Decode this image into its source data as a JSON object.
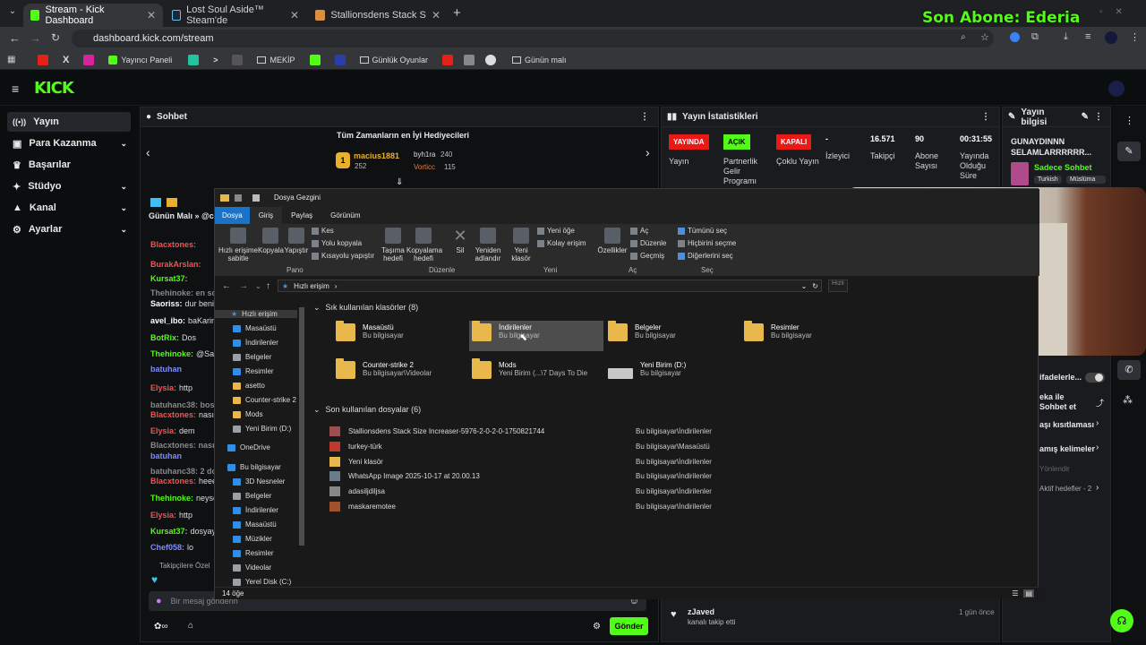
{
  "browser": {
    "tabs": [
      {
        "title": "Stream - Kick Dashboard",
        "active": true
      },
      {
        "title": "Lost Soul Aside™ Steam'de",
        "active": false
      },
      {
        "title": "Stallionsdens Stack Size Increas",
        "active": false
      }
    ],
    "url": "dashboard.kick.com/stream",
    "bookmarks": [
      "Yayıncı Paneli",
      "MEKİP",
      "Günlük Oyunlar",
      "Günün malı"
    ]
  },
  "overlay": {
    "text": "Son Abone: Ederia"
  },
  "kick": {
    "logo": "KICK",
    "nav": [
      {
        "label": "Yayın",
        "chevron": false
      },
      {
        "label": "Para Kazanma",
        "chevron": true
      },
      {
        "label": "Başarılar",
        "chevron": false
      },
      {
        "label": "Stüdyo",
        "chevron": true
      },
      {
        "label": "Kanal",
        "chevron": true
      },
      {
        "label": "Ayarlar",
        "chevron": true
      }
    ],
    "chat": {
      "title": "Sohbet",
      "gifters_title": "Tüm Zamanların en İyi Hediyecileri",
      "gifters": [
        {
          "name": "macius1881",
          "count": "252"
        },
        {
          "name": "byh1ra",
          "count": "240"
        },
        {
          "name": "Vorticc",
          "count": "115"
        }
      ],
      "pinned": "Günün Malı » @c",
      "messages": [
        {
          "user": "Blacxtones:",
          "text": "",
          "color": "#ff4d4d"
        },
        {
          "user": "BurakArslan:",
          "text": "",
          "color": "#ff4d4d"
        },
        {
          "user": "Kursat37:",
          "text": "",
          "color": "#53fc18"
        },
        {
          "user": "Thehinoke: en son",
          "text": "",
          "color": "#888"
        },
        {
          "user": "Saoriss:",
          "text": "dur benim",
          "color": "#fff"
        },
        {
          "user": "avel_ibo:",
          "text": "baKarim",
          "color": "#fff"
        },
        {
          "user": "BotRix:",
          "text": "Dos",
          "color": "#53fc18"
        },
        {
          "user": "Thehinoke:",
          "text": "@Saori",
          "color": "#53fc18"
        },
        {
          "user": "batuhan",
          "text": "",
          "color": "#7f8cff"
        },
        {
          "user": "Elysia:",
          "text": "http",
          "color": "#ff4d4d"
        },
        {
          "user": "batuhanc38: bos",
          "text": "",
          "color": "#888"
        },
        {
          "user": "Blacxtones:",
          "text": "nasıl k",
          "color": "#ff4d4d"
        },
        {
          "user": "Elysia:",
          "text": "dem",
          "color": "#ff4d4d"
        },
        {
          "user": "Blacxtones: nasıl",
          "text": "",
          "color": "#888"
        },
        {
          "user": "batuhan",
          "text": "",
          "color": "#7f8cff"
        },
        {
          "user": "batuhanc38: 2 do",
          "text": "",
          "color": "#888"
        },
        {
          "user": "Blacxtones:",
          "text": "heee k",
          "color": "#ff4d4d"
        },
        {
          "user": "Thehinoke:",
          "text": "neyse",
          "color": "#53fc18"
        },
        {
          "user": "Elysia:",
          "text": "http",
          "color": "#ff4d4d"
        },
        {
          "user": "Kursat37:",
          "text": "dosyayı",
          "color": "#53fc18"
        },
        {
          "user": "Chef058:",
          "text": "lo",
          "color": "#7f8cff"
        }
      ],
      "followers_only": "Takipçilere Özel",
      "input_placeholder": "Bir mesaj gönderin",
      "send": "Gönder"
    },
    "stats": {
      "title": "Yayın İstatistikleri",
      "badges": [
        {
          "label": "YAYINDA",
          "color": "#e91916",
          "caption": "Yayın"
        },
        {
          "label": "AÇIK",
          "color": "#53fc18",
          "caption": "Partnerlik Gelir Programı"
        },
        {
          "label": "KAPALI",
          "color": "#e91916",
          "caption": "Çoklu Yayın"
        }
      ],
      "values": [
        {
          "value": "-",
          "caption": "İzleyici"
        },
        {
          "value": "16.571",
          "caption": "Takipçi"
        },
        {
          "value": "90",
          "caption": "Abone Sayısı"
        },
        {
          "value": "00:31:55",
          "caption": "Yayında Olduğu Süre"
        }
      ]
    },
    "info": {
      "title": "Yayın bilgisi",
      "stream_title": "GUNAYDINNN SELAMLARRRRRR...",
      "category": "Sadece Sohbet",
      "tags": [
        "Turkish",
        "Müslüma"
      ],
      "settings": [
        "ifadelerle...",
        "eka ile Sohbet et",
        "aşı kısıtlaması",
        "amış kelimeler",
        "Yönlendir",
        "Aktif hedefler - 2"
      ]
    },
    "activity": {
      "user": "zJaved",
      "text": "kanalı takip etti",
      "time": "1 gün önce"
    }
  },
  "explorer": {
    "title": "Dosya Gezgini",
    "tabs": [
      "Dosya",
      "Giriş",
      "Paylaş",
      "Görünüm"
    ],
    "ribbon": {
      "pin": "Hızlı erişime sabitle",
      "copy": "Kopyala",
      "paste": "Yapıştır",
      "cut": "Kes",
      "copy_path": "Yolu kopyala",
      "paste_shortcut": "Kısayolu yapıştır",
      "move_to": "Taşıma hedefi",
      "copy_to": "Kopyalama hedefi",
      "delete": "Sil",
      "rename": "Yeniden adlandır",
      "new_folder": "Yeni klasör",
      "new_item": "Yeni öğe",
      "easy_access": "Kolay erişim",
      "properties": "Özellikler",
      "open": "Aç",
      "edit": "Düzenle",
      "history": "Geçmiş",
      "select_all": "Tümünü seç",
      "select_none": "Hiçbirini seçme",
      "invert": "Diğerlerini seç",
      "groups": [
        "Pano",
        "Düzenle",
        "Yeni",
        "Aç",
        "Seç"
      ]
    },
    "path": "Hızlı erişim",
    "search_placeholder": "Hızlı",
    "nav": [
      {
        "label": "Hızlı erişim",
        "type": "star"
      },
      {
        "label": "Masaüstü",
        "type": "b"
      },
      {
        "label": "İndirilenler",
        "type": "b"
      },
      {
        "label": "Belgeler",
        "type": "g"
      },
      {
        "label": "Resimler",
        "type": "b"
      },
      {
        "label": "asetto",
        "type": "f"
      },
      {
        "label": "Counter-strike 2",
        "type": "f"
      },
      {
        "label": "Mods",
        "type": "f"
      },
      {
        "label": "Yeni Birim (D:)",
        "type": "g"
      },
      {
        "label": "OneDrive",
        "type": "b"
      },
      {
        "label": "Bu bilgisayar",
        "type": "b"
      },
      {
        "label": "3D Nesneler",
        "type": "b"
      },
      {
        "label": "Belgeler",
        "type": "g"
      },
      {
        "label": "İndirilenler",
        "type": "b"
      },
      {
        "label": "Masaüstü",
        "type": "b"
      },
      {
        "label": "Müzikler",
        "type": "b"
      },
      {
        "label": "Resimler",
        "type": "b"
      },
      {
        "label": "Videolar",
        "type": "g"
      },
      {
        "label": "Yerel Disk (C:)",
        "type": "g"
      }
    ],
    "frequent_title": "Sık kullanılan klasörler (8)",
    "frequent": [
      {
        "name": "Masaüstü",
        "loc": "Bu bilgisayar"
      },
      {
        "name": "İndirilenler",
        "loc": "Bu bilgisayar"
      },
      {
        "name": "Belgeler",
        "loc": "Bu bilgisayar"
      },
      {
        "name": "Resimler",
        "loc": "Bu bilgisayar"
      },
      {
        "name": "Counter-strike 2",
        "loc": "Bu bilgisayar\\Videolar"
      },
      {
        "name": "Mods",
        "loc": "Yeni Birim (...\\7 Days To Die"
      },
      {
        "name": "Yeni Birim (D:)",
        "loc": "Bu bilgisayar"
      }
    ],
    "recent_title": "Son kullanılan dosyalar (6)",
    "recent": [
      {
        "name": "Stallionsdens Stack Size Increaser-5976-2-0-2-0-1750821744",
        "loc": "Bu bilgisayar\\İndirilenler"
      },
      {
        "name": "turkey-türk",
        "loc": "Bu bilgisayar\\Masaüstü"
      },
      {
        "name": "Yeni klasör",
        "loc": "Bu bilgisayar\\İndirilenler"
      },
      {
        "name": "WhatsApp Image 2025-10-17 at 20.00.13",
        "loc": "Bu bilgisayar\\İndirilenler"
      },
      {
        "name": "adasiljdiljsa",
        "loc": "Bu bilgisayar\\İndirilenler"
      },
      {
        "name": "maskaremotee",
        "loc": "Bu bilgisayar\\İndirilenler"
      }
    ],
    "status": "14 öğe"
  }
}
